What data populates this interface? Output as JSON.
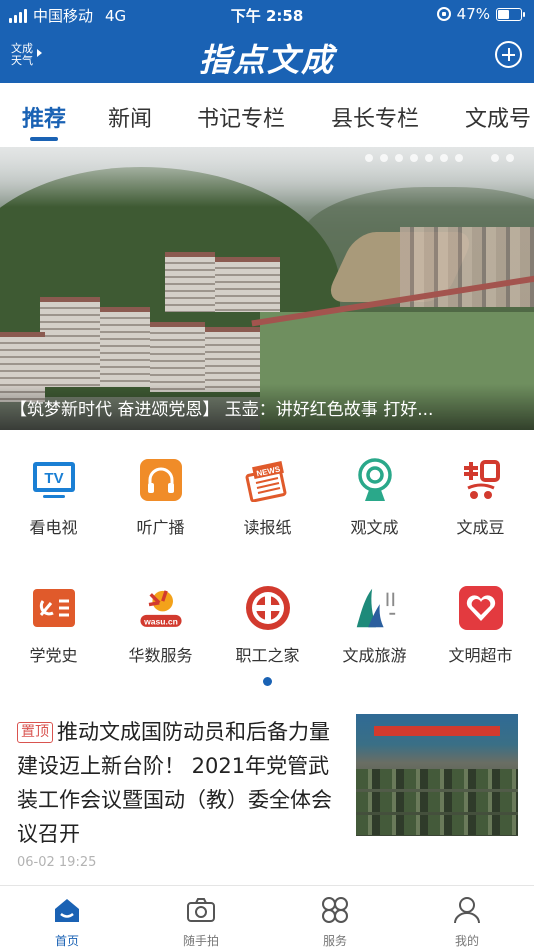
{
  "status_bar": {
    "carrier": "中国移动",
    "network": "4G",
    "time": "下午 2:58",
    "battery": "47%",
    "battery_level": 0.47
  },
  "header": {
    "weather_line1": "文成",
    "weather_line2": "天气",
    "title": "指点文成"
  },
  "tabs": [
    {
      "label": "推荐",
      "active": true
    },
    {
      "label": "新闻"
    },
    {
      "label": "书记专栏"
    },
    {
      "label": "县长专栏"
    },
    {
      "label": "文成号"
    }
  ],
  "banner": {
    "caption": "【筑梦新时代 奋进颂党恩】 玉壶：讲好红色故事 打好..."
  },
  "quick_grid": [
    {
      "label": "看电视",
      "icon": "tv-icon"
    },
    {
      "label": "听广播",
      "icon": "headphones-icon"
    },
    {
      "label": "读报纸",
      "icon": "newspaper-icon"
    },
    {
      "label": "观文成",
      "icon": "webcam-icon"
    },
    {
      "label": "文成豆",
      "icon": "wenchengdou-logo-icon"
    },
    {
      "label": "学党史",
      "icon": "party-history-icon"
    },
    {
      "label": "华数服务",
      "icon": "wasu-logo-icon"
    },
    {
      "label": "职工之家",
      "icon": "trade-union-icon"
    },
    {
      "label": "文成旅游",
      "icon": "tourism-logo-icon"
    },
    {
      "label": "文明超市",
      "icon": "heart-hands-icon"
    }
  ],
  "icon_texts": {
    "tv": "TV",
    "news": "NEWS",
    "wasu": "wasu.cn"
  },
  "news": {
    "tag": "置顶",
    "title": "推动文成国防动员和后备力量建设迈上新台阶！ 2021年党管武装工作会议暨国动（教）委全体会议召开",
    "date": "06-02 19:25"
  },
  "bottom_nav": [
    {
      "label": "首页",
      "icon": "home-icon",
      "active": true
    },
    {
      "label": "随手拍",
      "icon": "camera-icon"
    },
    {
      "label": "服务",
      "icon": "services-icon"
    },
    {
      "label": "我的",
      "icon": "user-icon"
    }
  ],
  "colors": {
    "brand": "#1a62b4",
    "pin_tag": "#d9534f",
    "icon_orange": "#f08c28",
    "icon_red": "#d23a2e",
    "icon_teal": "#2aa88a"
  }
}
